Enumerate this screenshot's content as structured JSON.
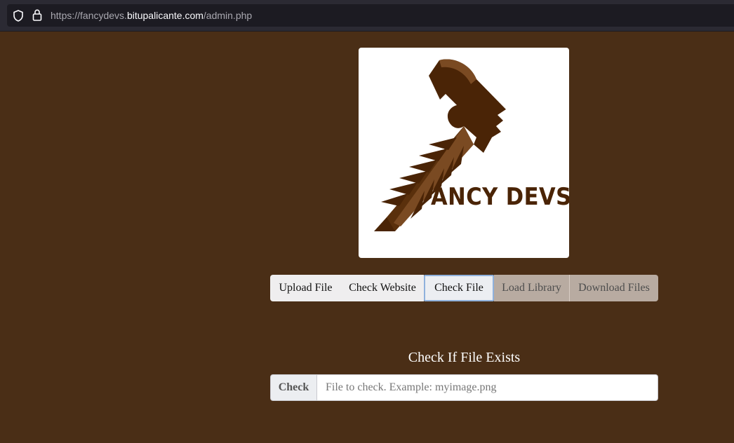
{
  "browser": {
    "url_prefix": "https://fancydevs.",
    "url_domain": "bitupalicante.com",
    "url_path": "/admin.php"
  },
  "logo": {
    "text": "ANCY DEVS",
    "color": "#4a2406"
  },
  "nav": {
    "items": [
      {
        "label": "Upload File"
      },
      {
        "label": "Check Website"
      },
      {
        "label": "Check File"
      },
      {
        "label": "Load Library"
      },
      {
        "label": "Download Files"
      }
    ]
  },
  "check_section": {
    "title": "Check If File Exists",
    "button_label": "Check",
    "input_value": "",
    "input_placeholder": "File to check. Example: myimage.png"
  },
  "colors": {
    "page_background": "#4a2e16",
    "browser_bar": "#2b2a33",
    "active_tab_border": "#8fb1dc",
    "disabled_tab": "#b8aba1"
  }
}
